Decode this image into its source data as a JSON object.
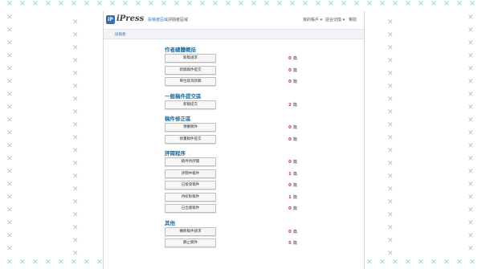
{
  "header": {
    "logo_mark": "iP",
    "app_name": "iPress",
    "nav_active": "投稿者區域",
    "nav_review": "評閱者區域",
    "account_label": "我的帳戶 ▾",
    "language_label": "語言切換 ▾",
    "help_label": "幫助"
  },
  "breadcrumb": "投稿者",
  "count_unit": "篇",
  "sections": [
    {
      "title": "作者總體概括",
      "items": [
        {
          "label": "新稿請求",
          "count": "0"
        },
        {
          "label": "新稿稿件提交",
          "count": "0"
        },
        {
          "label": "單位取消新稿",
          "count": "0"
        }
      ]
    },
    {
      "title": "一般稿件提交區",
      "items": [
        {
          "label": "新稿提交",
          "count": "2"
        }
      ]
    },
    {
      "title": "稿件修正區",
      "items": [
        {
          "label": "預審稿件",
          "count": "0"
        },
        {
          "label": "修畫稿件提交",
          "count": "0"
        }
      ]
    },
    {
      "title": "評閱程序",
      "items": [
        {
          "label": "稿件待評閱",
          "count": "0"
        },
        {
          "label": "評閱中稿件",
          "count": "1"
        },
        {
          "label": "已接受稿件",
          "count": "0"
        },
        {
          "label": "待校對稿件",
          "count": "1"
        },
        {
          "label": "已出版稿件",
          "count": "0"
        }
      ]
    },
    {
      "title": "其他",
      "items": [
        {
          "label": "轉移稿件請求",
          "count": "0"
        },
        {
          "label": "靜止稿件",
          "count": "5"
        }
      ]
    }
  ]
}
